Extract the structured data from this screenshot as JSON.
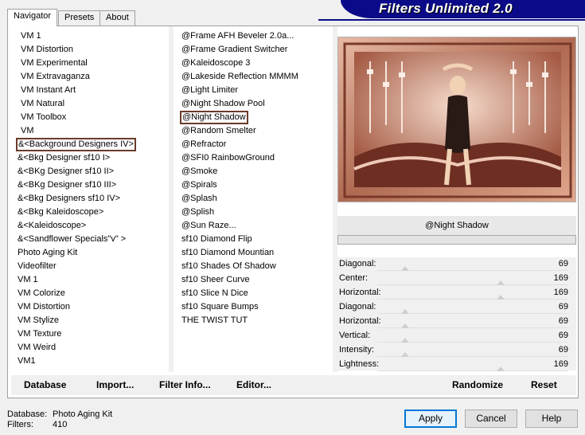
{
  "tabs": [
    "Navigator",
    "Presets",
    "About"
  ],
  "banner_title": "Filters Unlimited 2.0",
  "categories": [
    "VM 1",
    "VM Distortion",
    "VM Experimental",
    "VM Extravaganza",
    "VM Instant Art",
    "VM Natural",
    "VM Toolbox",
    "VM",
    "&<Background Designers IV>",
    "&<Bkg Designer sf10 I>",
    "&<BKg Designer sf10 II>",
    "&<BKg Designer sf10 III>",
    "&<Bkg Designers sf10 IV>",
    "&<Bkg Kaleidoscope>",
    "&<Kaleidoscope>",
    "&<Sandflower Specials\"v\" >",
    "Photo Aging Kit",
    "Videofilter",
    "VM 1",
    "VM Colorize",
    "VM Distortion",
    "VM Stylize",
    "VM Texture",
    "VM Weird",
    "VM1"
  ],
  "selected_category_index": 8,
  "filters": [
    "@Frame AFH Beveler 2.0a...",
    "@Frame Gradient Switcher",
    "@Kaleidoscope 3",
    "@Lakeside Reflection MMMM",
    "@Light Limiter",
    "@Night Shadow Pool",
    "@Night Shadow",
    "@Random Smelter",
    "@Refractor",
    "@SFI0 RainbowGround",
    "@Smoke",
    "@Spirals",
    "@Splash",
    "@Splish",
    "@Sun Raze...",
    "sf10 Diamond Flip",
    "sf10 Diamond Mountian",
    "sf10 Shades Of Shadow",
    "sf10 Sheer Curve",
    "sf10 Slice N Dice",
    "sf10 Square Bumps",
    "THE TWIST TUT"
  ],
  "selected_filter_index": 6,
  "filter_name": "@Night Shadow",
  "params": [
    {
      "label": "Diagonal:",
      "value": "69"
    },
    {
      "label": "Center:",
      "value": "169"
    },
    {
      "label": "Horizontal:",
      "value": "169"
    },
    {
      "label": "Diagonal:",
      "value": "69"
    },
    {
      "label": "Horizontal:",
      "value": "69"
    },
    {
      "label": "Vertical:",
      "value": "69"
    },
    {
      "label": "Intensity:",
      "value": "69"
    },
    {
      "label": "Lightness:",
      "value": "169"
    }
  ],
  "strip_buttons": {
    "database": "Database",
    "import": "Import...",
    "filter_info": "Filter Info...",
    "editor": "Editor...",
    "randomize": "Randomize",
    "reset": "Reset"
  },
  "footer": {
    "database_label": "Database:",
    "database_value": "Photo Aging Kit",
    "filters_label": "Filters:",
    "filters_value": "410"
  },
  "dialog_buttons": {
    "apply": "Apply",
    "cancel": "Cancel",
    "help": "Help"
  },
  "colors": {
    "banner": "#0b0b8a",
    "selection_border": "#6b3a2a",
    "preview_bg": "#c88f78"
  }
}
